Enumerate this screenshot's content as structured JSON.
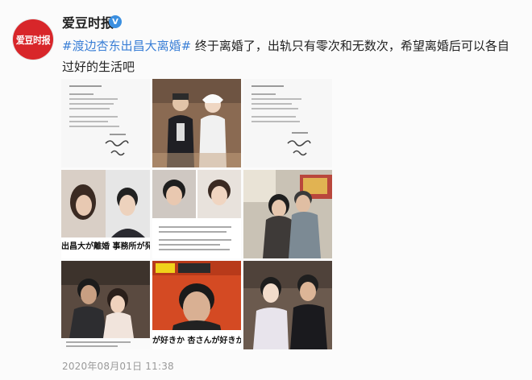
{
  "account": {
    "avatar_text": "爱豆时报",
    "name": "爱豆时报",
    "verified_badge": "V"
  },
  "post": {
    "hashtag": "#渡边杏东出昌大离婚#",
    "body": " 终于离婚了，出轨只有零次和无数次，希望离婚后可以各自过好的生活吧",
    "timestamp": "2020年08月01日 11:38"
  },
  "images": [
    {
      "id": "image-1",
      "overlay": ""
    },
    {
      "id": "image-2",
      "overlay": ""
    },
    {
      "id": "image-3",
      "overlay": ""
    },
    {
      "id": "image-4",
      "overlay": "出昌大が離婚 事務所が発"
    },
    {
      "id": "image-5",
      "overlay": ""
    },
    {
      "id": "image-6",
      "overlay": ""
    },
    {
      "id": "image-7",
      "overlay": ""
    },
    {
      "id": "image-8",
      "overlay": "が好きか 杏さんが好きか"
    },
    {
      "id": "image-9",
      "overlay": ""
    }
  ],
  "colors": {
    "brand_red": "#d8262a",
    "hashtag_blue": "#3a7fd6",
    "verified_blue": "#3b8fe0"
  }
}
